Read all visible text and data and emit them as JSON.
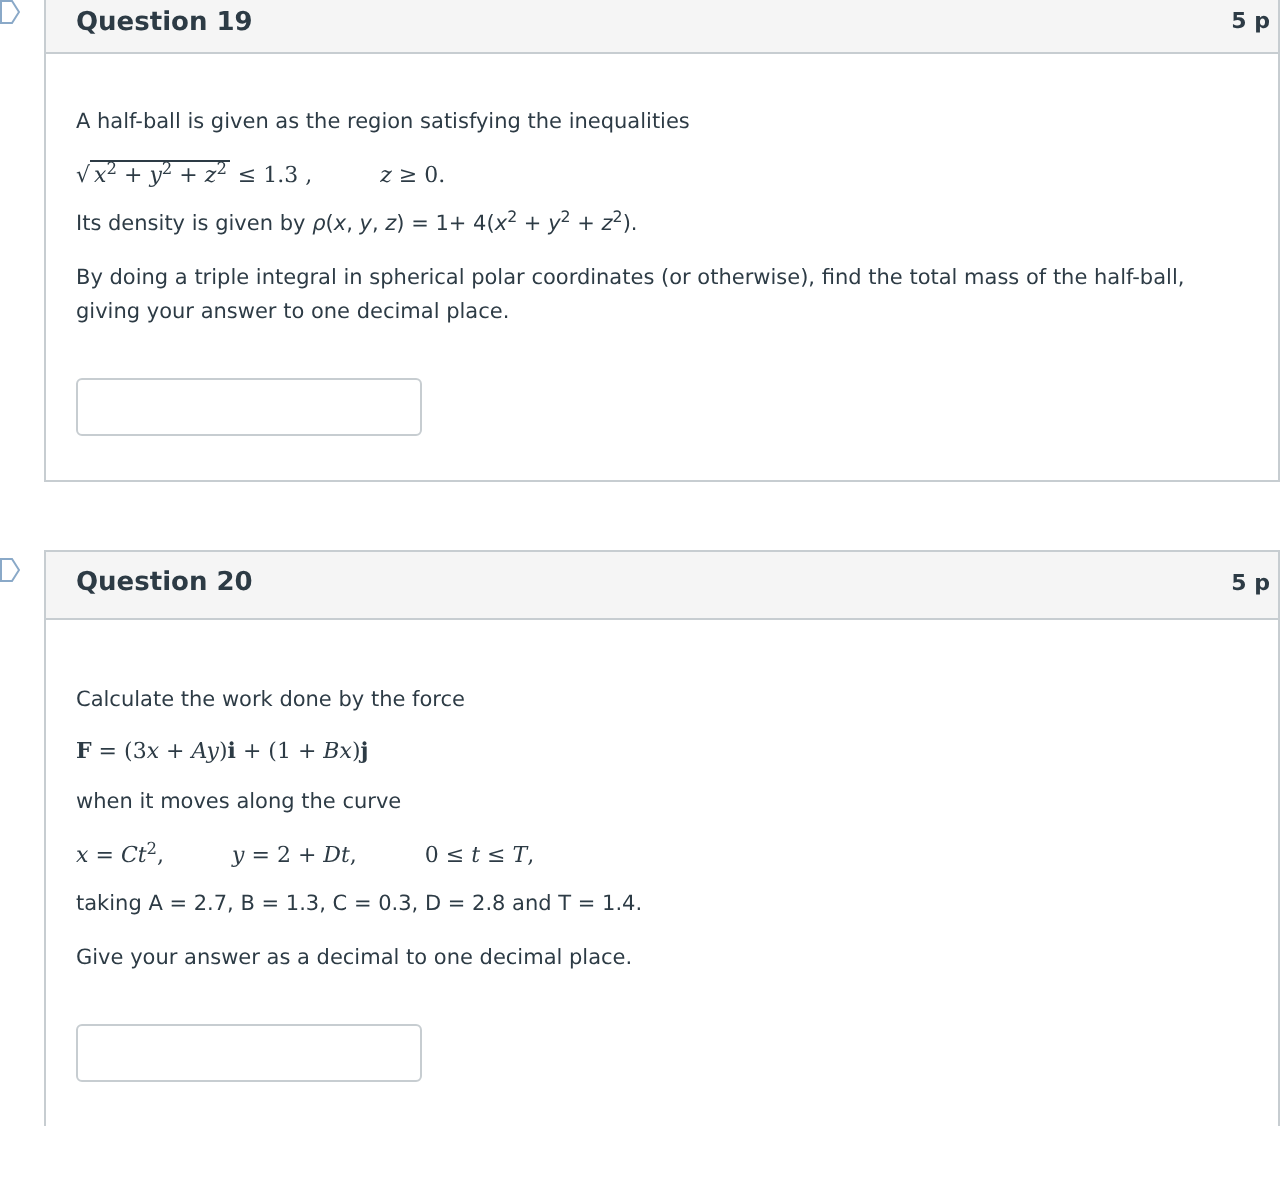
{
  "questions": [
    {
      "title": "Question 19",
      "points": "5 p",
      "blocks": [
        {
          "kind": "text",
          "text": "A half-ball is given as the region satisfying the inequalities"
        },
        {
          "kind": "math",
          "parts": [
            {
              "root": "√",
              "radicand": "*x*$^{2}$ + *y*$^{2}$ + *z*$^{2}$",
              "after": "≤ 1.3 ,"
            },
            {
              "after": "*z* ≥ 0."
            }
          ]
        },
        {
          "kind": "text",
          "text": "Its density is given by *ρ*(*x*, *y*, *z*) = 1+ 4(*x*$^{2}$ + *y*$^{2}$ + *z*$^{2}$)."
        },
        {
          "kind": "text",
          "text": "By doing a triple integral in spherical polar coordinates (or otherwise), find the total mass of the half-ball, giving your answer to one decimal place."
        }
      ]
    },
    {
      "title": "Question 20",
      "points": "5 p",
      "blocks": [
        {
          "kind": "text",
          "text": "Calculate the work done by the force"
        },
        {
          "kind": "math",
          "parts": [
            {
              "after": [
                "**F** = (3",
                "*x* + *Ay*)**i** + (1 + *Bx*)**j**"
              ]
            }
          ]
        },
        {
          "kind": "text",
          "text": "when it moves along the curve"
        },
        {
          "kind": "math",
          "parts": [
            {
              "after": "*x* = *Ct*$^{2}$,"
            },
            {
              "after": "*y* = 2 + *Dt*,"
            },
            {
              "after": "0 ≤ *t* ≤ *T*,"
            }
          ]
        },
        {
          "kind": "text",
          "text": "taking A = 2.7, B = 1.3, C = 0.3, D = 2.8 and T = 1.4."
        },
        {
          "kind": "text",
          "text": "Give your answer as a decimal to one decimal place."
        }
      ]
    }
  ]
}
